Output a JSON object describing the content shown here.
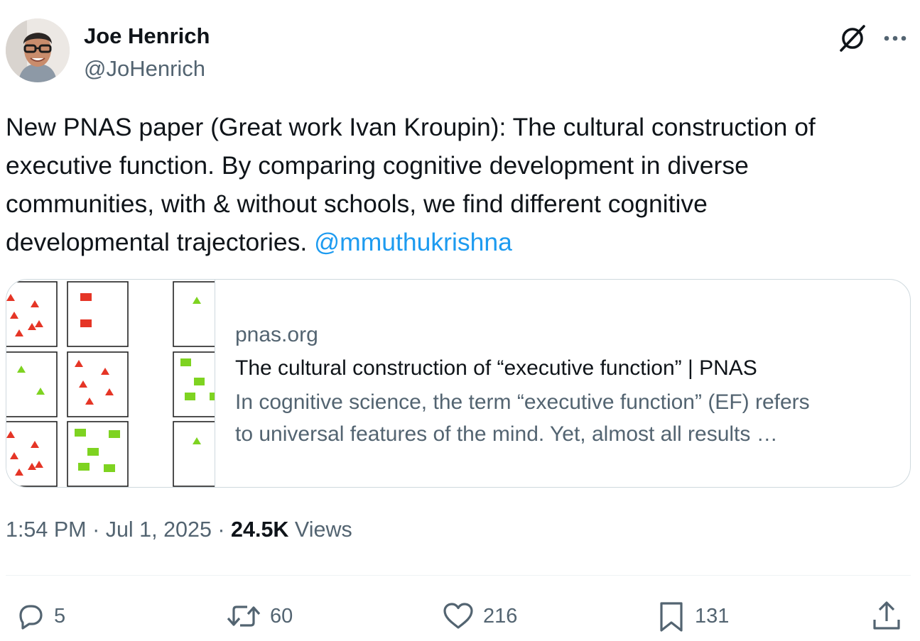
{
  "author": {
    "name": "Joe Henrich",
    "handle": "@JoHenrich"
  },
  "header_icons": {
    "grok": "grok-icon",
    "more": "more-icon"
  },
  "tweet": {
    "lines": [
      "New PNAS paper (Great work Ivan Kroupin): The cultural construction of",
      "executive function. By comparing cognitive development in diverse",
      "communities, with & without schools, we find  different cognitive",
      "developmental trajectories. "
    ],
    "mention": "@mmuthukrishna"
  },
  "card": {
    "domain": "pnas.org",
    "title": "The cultural construction of “executive function” | PNAS",
    "description_lines": [
      "In cognitive science, the term “executive function” (EF) refers",
      "to universal features of the mind. Yet, almost all results …"
    ]
  },
  "meta": {
    "time": "1:54 PM",
    "separator": " · ",
    "date": "Jul 1, 2025",
    "views_count": "24.5K",
    "views_label": " Views"
  },
  "actions": {
    "replies": "5",
    "reposts": "60",
    "likes": "216",
    "bookmarks": "131"
  },
  "colors": {
    "text": "#0f1419",
    "secondary": "#536471",
    "link": "#1d9bf0",
    "border": "#cfd9de",
    "shape_red": "#e53526",
    "shape_green": "#7ed321"
  }
}
